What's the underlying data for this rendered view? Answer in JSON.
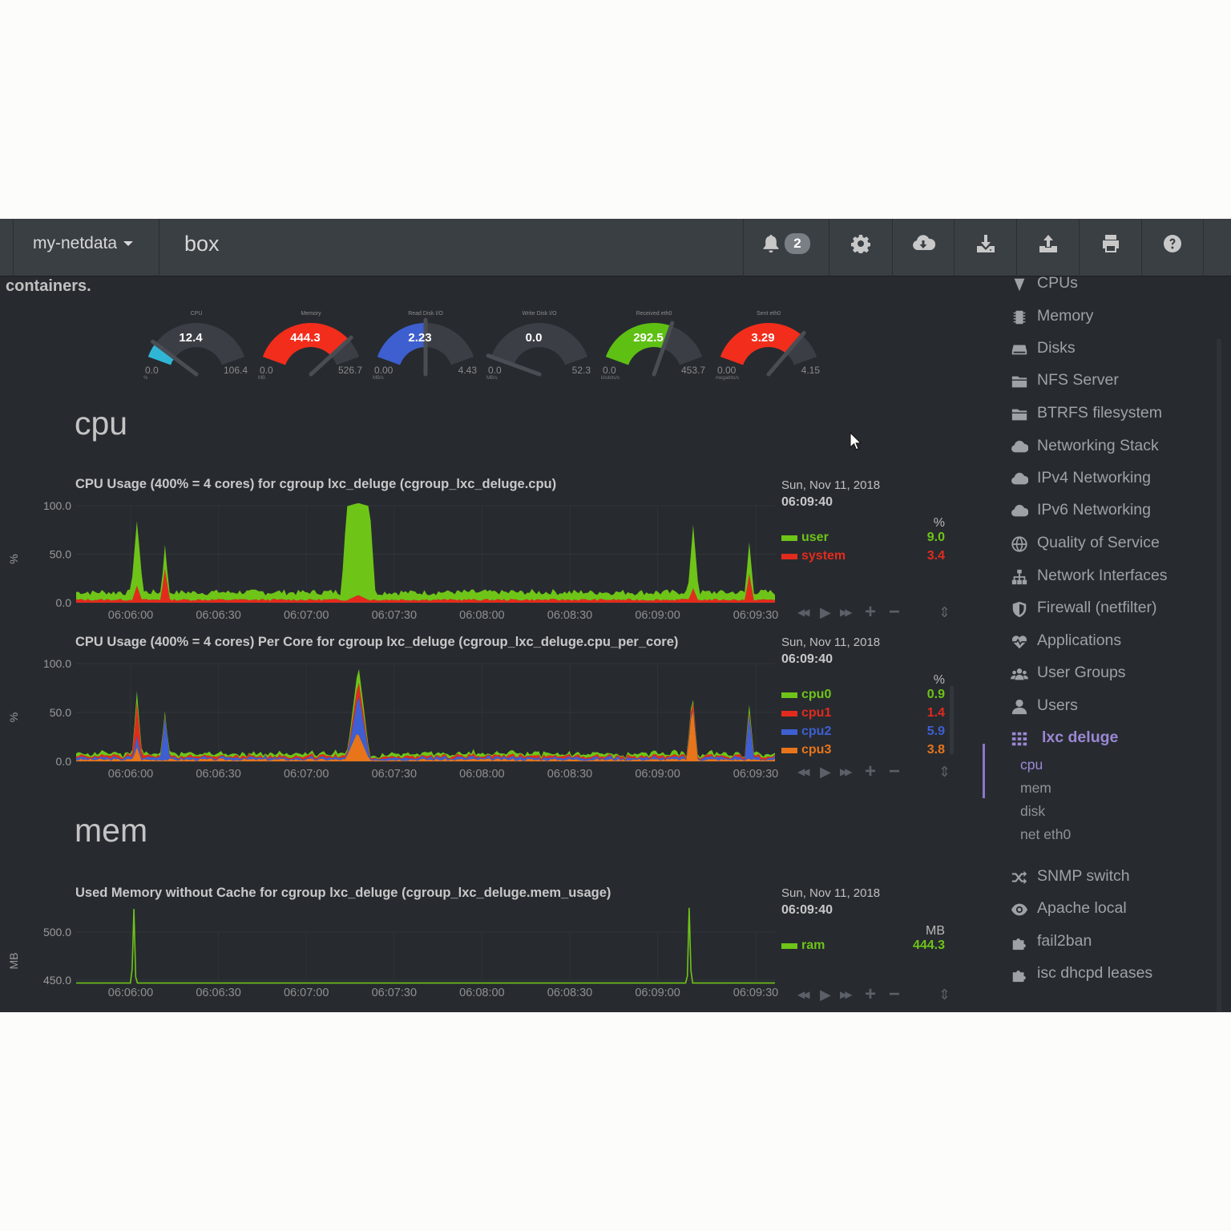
{
  "topbar": {
    "brand": "my-netdata",
    "host": "box",
    "alarm_count": "2",
    "icons": [
      "bell-icon",
      "gear-icon",
      "cloud-download-icon",
      "download-icon",
      "upload-icon",
      "print-icon",
      "question-icon"
    ]
  },
  "section_header": "containers.",
  "gauges": [
    {
      "title": "CPU",
      "value": "12.4",
      "min": "0.0",
      "max": "106.4",
      "unit": "%",
      "fraction": 0.12,
      "color": "#2fb6d6"
    },
    {
      "title": "Memory",
      "value": "444.3",
      "min": "0.0",
      "max": "526.7",
      "unit": "MB",
      "fraction": 0.84,
      "color": "#f22d1b"
    },
    {
      "title": "Read Disk I/O",
      "value": "2.23",
      "min": "0.00",
      "max": "4.43",
      "unit": "MB/s",
      "fraction": 0.5,
      "color": "#3d5fd0"
    },
    {
      "title": "Write Disk I/O",
      "value": "0.0",
      "min": "0.0",
      "max": "52.3",
      "unit": "MB/s",
      "fraction": 0.0,
      "color": "#2fb6d6"
    },
    {
      "title": "Received eth0",
      "value": "292.5",
      "min": "0.0",
      "max": "453.7",
      "unit": "kilobits/s",
      "fraction": 0.64,
      "color": "#5ec013"
    },
    {
      "title": "Sent eth0",
      "value": "3.29",
      "min": "0.00",
      "max": "4.15",
      "unit": "megabits/s",
      "fraction": 0.79,
      "color": "#f22d1b"
    }
  ],
  "families": {
    "cpu": "cpu",
    "mem": "mem"
  },
  "x_ticks": [
    "06:06:00",
    "06:06:30",
    "06:07:00",
    "06:07:30",
    "06:08:00",
    "06:08:30",
    "06:09:00",
    "06:09:30"
  ],
  "charts": {
    "cpu": {
      "title": "CPU Usage (400% = 4 cores) for cgroup lxc_deluge (cgroup_lxc_deluge.cpu)",
      "ylabel": "%",
      "yticks": [
        "100.0",
        "50.0",
        "0.0"
      ],
      "date": "Sun, Nov 11, 2018",
      "time": "06:09:40",
      "unit": "%",
      "series": [
        {
          "name": "user",
          "value": "9.0",
          "color": "#6fc418"
        },
        {
          "name": "system",
          "value": "3.4",
          "color": "#e32b1d"
        }
      ]
    },
    "cpu_per_core": {
      "title": "CPU Usage (400% = 4 cores) Per Core for cgroup lxc_deluge (cgroup_lxc_deluge.cpu_per_core)",
      "ylabel": "%",
      "yticks": [
        "100.0",
        "50.0",
        "0.0"
      ],
      "date": "Sun, Nov 11, 2018",
      "time": "06:09:40",
      "unit": "%",
      "series": [
        {
          "name": "cpu0",
          "value": "0.9",
          "color": "#6fc418"
        },
        {
          "name": "cpu1",
          "value": "1.4",
          "color": "#e32b1d"
        },
        {
          "name": "cpu2",
          "value": "5.9",
          "color": "#3e5fd1"
        },
        {
          "name": "cpu3",
          "value": "3.8",
          "color": "#e8751a"
        }
      ]
    },
    "mem_usage": {
      "title": "Used Memory without Cache for cgroup lxc_deluge (cgroup_lxc_deluge.mem_usage)",
      "ylabel": "MB",
      "yticks": [
        "500.0",
        "450.0"
      ],
      "date": "Sun, Nov 11, 2018",
      "time": "06:09:40",
      "unit": "MB",
      "series": [
        {
          "name": "ram",
          "value": "444.3",
          "color": "#6fc418"
        }
      ]
    }
  },
  "chart_data": [
    {
      "type": "area",
      "title": "CPU Usage (400% = 4 cores) for cgroup lxc_deluge (cgroup_lxc_deluge.cpu)",
      "ylabel": "%",
      "ylim": [
        0,
        100
      ],
      "x": [
        "06:06:00",
        "06:06:30",
        "06:07:00",
        "06:07:30",
        "06:08:00",
        "06:08:30",
        "06:09:00",
        "06:09:30"
      ],
      "series": [
        {
          "name": "user",
          "values": [
            8,
            7,
            9,
            8,
            7,
            8,
            9,
            9
          ]
        },
        {
          "name": "system",
          "values": [
            3,
            3,
            3,
            3,
            3,
            3,
            3,
            3.4
          ]
        }
      ],
      "peaks": [
        {
          "at": "06:05:55",
          "user": 75,
          "system": 18
        },
        {
          "at": "06:06:05",
          "user": 40,
          "system": 35
        },
        {
          "at": "06:07:10",
          "user": 100,
          "system": 8
        },
        {
          "at": "06:09:05",
          "user": 72,
          "system": 15
        },
        {
          "at": "06:09:30",
          "user": 45,
          "system": 30
        }
      ]
    },
    {
      "type": "area",
      "title": "CPU Usage (400% = 4 cores) Per Core for cgroup lxc_deluge (cgroup_lxc_deluge.cpu_per_core)",
      "ylabel": "%",
      "ylim": [
        0,
        100
      ],
      "x": [
        "06:06:00",
        "06:06:30",
        "06:07:00",
        "06:07:30",
        "06:08:00",
        "06:08:30",
        "06:09:00",
        "06:09:30"
      ],
      "series": [
        {
          "name": "cpu0",
          "values": [
            1,
            1,
            1,
            1,
            1,
            1,
            1,
            0.9
          ]
        },
        {
          "name": "cpu1",
          "values": [
            2,
            2,
            2,
            2,
            2,
            2,
            2,
            1.4
          ]
        },
        {
          "name": "cpu2",
          "values": [
            4,
            5,
            5,
            4,
            5,
            5,
            5,
            5.9
          ]
        },
        {
          "name": "cpu3",
          "values": [
            3,
            3,
            4,
            3,
            3,
            3,
            4,
            3.8
          ]
        }
      ]
    },
    {
      "type": "line",
      "title": "Used Memory without Cache for cgroup lxc_deluge (cgroup_lxc_deluge.mem_usage)",
      "ylabel": "MB",
      "ylim": [
        447,
        530
      ],
      "x": [
        "06:06:00",
        "06:06:30",
        "06:07:00",
        "06:07:30",
        "06:08:00",
        "06:08:30",
        "06:09:00",
        "06:09:30"
      ],
      "series": [
        {
          "name": "ram",
          "values": [
            447,
            447,
            447,
            447,
            447,
            447,
            447,
            447
          ]
        }
      ],
      "peaks": [
        {
          "at": "06:05:58",
          "ram": 528
        },
        {
          "at": "06:09:08",
          "ram": 528
        }
      ]
    }
  ],
  "sidebar": {
    "items": [
      {
        "label": "CPUs",
        "icon": "cpus-icon"
      },
      {
        "label": "Memory",
        "icon": "memory-icon"
      },
      {
        "label": "Disks",
        "icon": "disks-icon"
      },
      {
        "label": "NFS Server",
        "icon": "folder-icon"
      },
      {
        "label": "BTRFS filesystem",
        "icon": "folder-icon"
      },
      {
        "label": "Networking Stack",
        "icon": "cloud-icon"
      },
      {
        "label": "IPv4 Networking",
        "icon": "cloud-icon"
      },
      {
        "label": "IPv6 Networking",
        "icon": "cloud-icon"
      },
      {
        "label": "Quality of Service",
        "icon": "globe-icon"
      },
      {
        "label": "Network Interfaces",
        "icon": "sitemap-icon"
      },
      {
        "label": "Firewall (netfilter)",
        "icon": "shield-icon"
      },
      {
        "label": "Applications",
        "icon": "heartbeat-icon"
      },
      {
        "label": "User Groups",
        "icon": "users-icon"
      },
      {
        "label": "Users",
        "icon": "user-icon"
      },
      {
        "label": "lxc deluge",
        "icon": "grid-icon",
        "active": true
      },
      {
        "label": "SNMP switch",
        "icon": "random-icon"
      },
      {
        "label": "Apache local",
        "icon": "eye-icon"
      },
      {
        "label": "fail2ban",
        "icon": "puzzle-icon"
      },
      {
        "label": "isc dhcpd leases",
        "icon": "puzzle-icon"
      }
    ],
    "sub_items": [
      "cpu",
      "mem",
      "disk",
      "net eth0"
    ]
  }
}
